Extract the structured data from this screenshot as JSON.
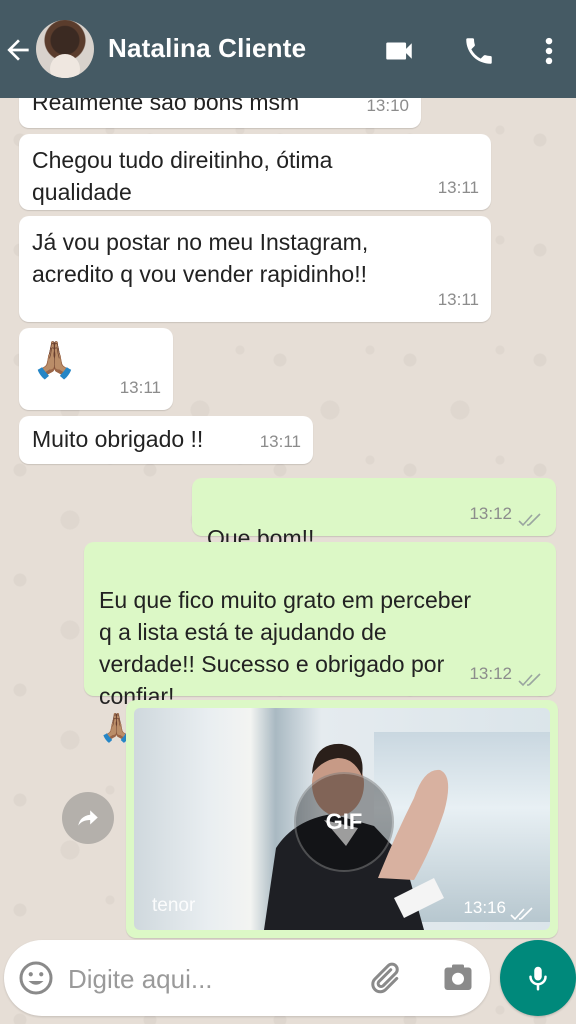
{
  "header": {
    "contact_name": "Natalina Cliente"
  },
  "messages": [
    {
      "text": "Realmente são bons msm",
      "time": "13:10"
    },
    {
      "text": "Chegou tudo direitinho, ótima\nqualidade",
      "time": "13:11"
    },
    {
      "text": "Já vou postar no meu Instagram,\nacredito q vou vender rapidinho!!",
      "time": "13:11"
    },
    {
      "text": "🙏🏽",
      "time": "13:11"
    },
    {
      "text": "Muito obrigado !!",
      "time": "13:11"
    },
    {
      "text": "Que bom!!",
      "time": "13:12"
    },
    {
      "text": "Eu que fico muito grato em perceber\nq a lista está te ajudando de\nverdade!! Sucesso e obrigado por\nconfiar!",
      "emoji_suffix": "🙏🏽👏🏽",
      "time": "13:12"
    }
  ],
  "gif": {
    "badge": "GIF",
    "source": "tenor",
    "time": "13:16"
  },
  "composer": {
    "placeholder": "Digite aqui..."
  },
  "icons": {
    "back": "arrow-left-icon",
    "video": "video-call-icon",
    "phone": "phone-icon",
    "menu": "more-vert-icon",
    "emoji": "emoji-icon",
    "attach": "paperclip-icon",
    "camera": "camera-icon",
    "mic": "mic-icon",
    "forward": "forward-icon",
    "read": "double-check-icon"
  },
  "colors": {
    "header": "#455a64",
    "incoming_bubble": "#ffffff",
    "outgoing_bubble": "#dcf8c6",
    "mic_button": "#00897b",
    "chat_background": "#e6ded6"
  }
}
